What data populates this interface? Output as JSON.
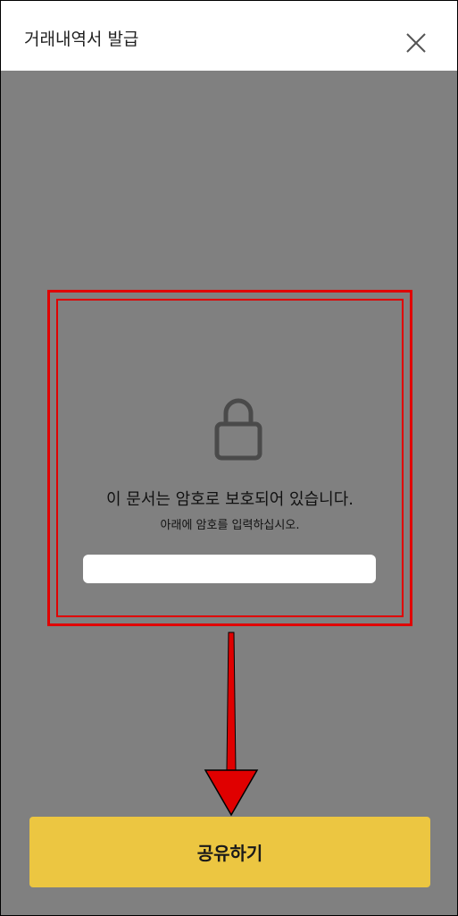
{
  "header": {
    "title": "거래내역서 발급",
    "close_icon": "close-icon"
  },
  "protected_dialog": {
    "lock_icon": "lock-icon",
    "message": "이 문서는 암호로 보호되어 있습니다.",
    "instruction": "아래에 암호를 입력하십시오.",
    "password_value": "",
    "password_placeholder": ""
  },
  "annotation": {
    "highlight_color": "#e00000",
    "arrow_icon": "arrow-down-icon"
  },
  "footer": {
    "share_label": "공유하기",
    "share_color": "#ecc641"
  }
}
